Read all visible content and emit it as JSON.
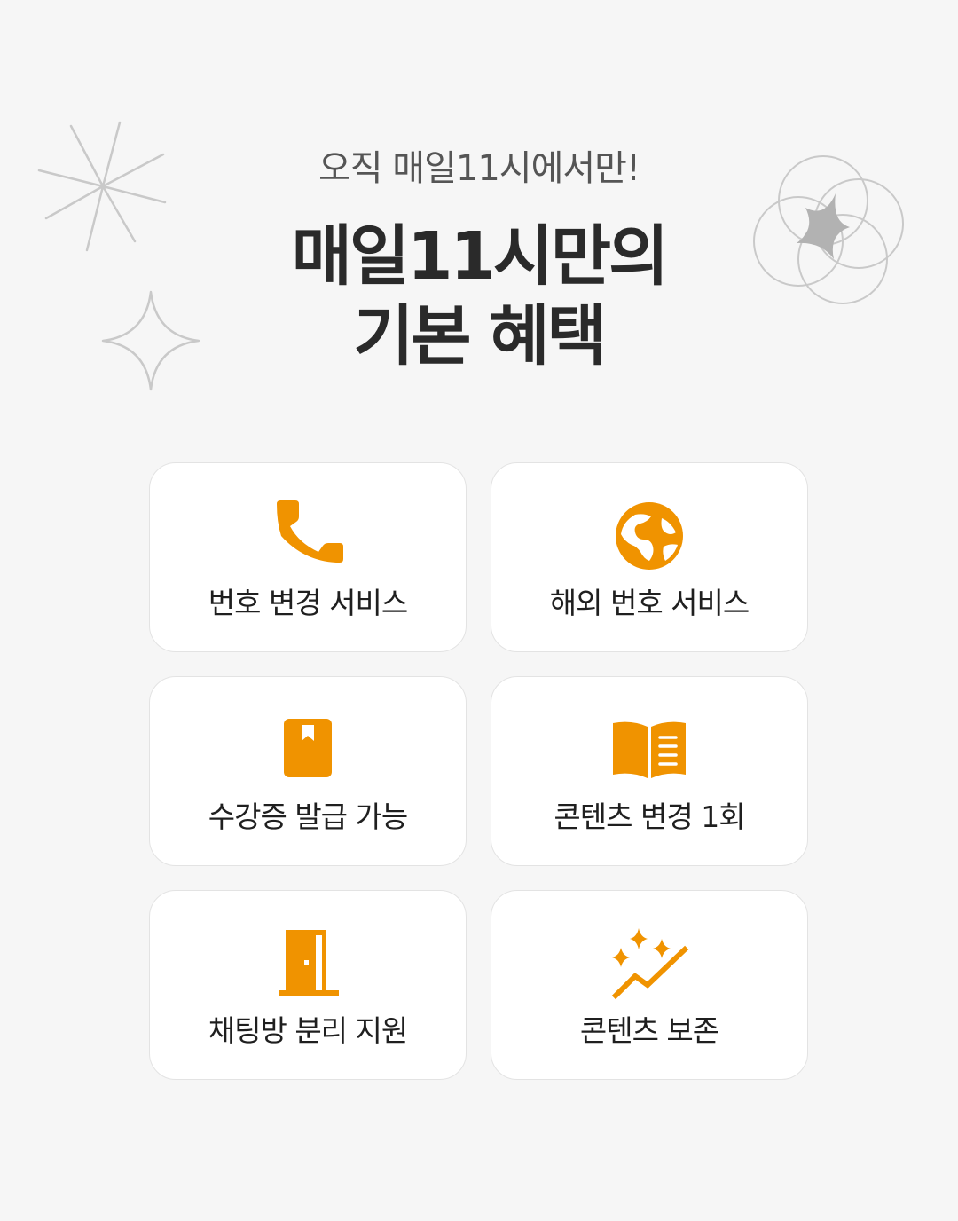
{
  "header": {
    "subtitle": "오직 매일11시에서만!",
    "title_line1": "매일11시만의",
    "title_line2": "기본 혜택"
  },
  "accent_color": "#f09300",
  "benefits": [
    {
      "icon": "phone-icon",
      "label": "번호 변경 서비스"
    },
    {
      "icon": "globe-icon",
      "label": "해외 번호 서비스"
    },
    {
      "icon": "bookmark-book-icon",
      "label": "수강증 발급 가능"
    },
    {
      "icon": "open-book-icon",
      "label": "콘텐츠 변경 1회"
    },
    {
      "icon": "door-icon",
      "label": "채팅방 분리 지원"
    },
    {
      "icon": "sparkle-trend-icon",
      "label": "콘텐츠 보존"
    }
  ]
}
